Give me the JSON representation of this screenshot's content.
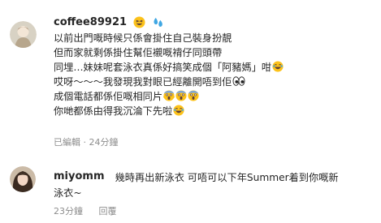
{
  "comments": [
    {
      "username": "coffee89921",
      "head_emoji": [
        "grinning-squinting-emoji",
        "sweat-droplets-emoji"
      ],
      "lines": [
        {
          "text": "以前出門嘅時候只係會掛住自己裝身扮靚",
          "emoji": []
        },
        {
          "text": "但而家就剩係掛住幫佢襯嘅褙仔同頭帶",
          "emoji": []
        },
        {
          "text": "同埋…妹妹呢套泳衣真係好搞笑成個「阿豬媽」咁",
          "emoji": [
            "laughing-emoji"
          ]
        },
        {
          "text": "哎呀～～～我發現我對眼已經離開唔到佢",
          "emoji": [
            "eyes-emoji"
          ]
        },
        {
          "text": "成個電話都係佢嘅相同片",
          "emoji": [
            "screaming-emoji",
            "screaming-emoji",
            "screaming-emoji"
          ]
        },
        {
          "text": "你哋都係由得我沉淪下先啦",
          "emoji": [
            "laughing-emoji"
          ]
        }
      ],
      "status": "已編輯",
      "time": "24分鐘"
    },
    {
      "username": "miyomm",
      "text_line1": "幾時再出新泳衣 可唔可以下年Summer着到你嘅新",
      "text_line2": "泳衣~",
      "time": "23分鐘",
      "reply_label": "回覆"
    }
  ]
}
